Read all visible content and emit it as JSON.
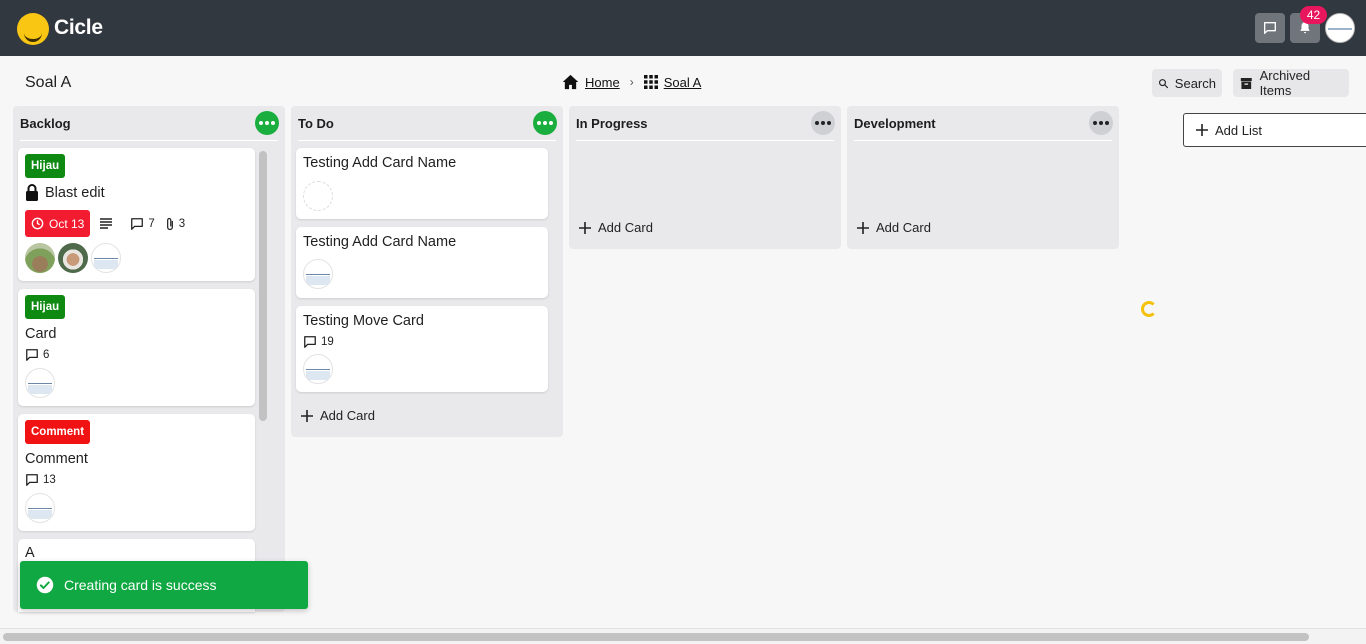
{
  "app": {
    "name": "Cicle",
    "notification_count": "42"
  },
  "header": {
    "page_title": "Soal A",
    "breadcrumb": [
      {
        "label": "Home",
        "icon": "home-icon"
      },
      {
        "label": "Soal A",
        "icon": "grid-icon"
      }
    ],
    "search_label": "Search",
    "archived_label": "Archived Items"
  },
  "lists": [
    {
      "title": "Backlog",
      "cards": [
        {
          "label": "Hijau",
          "title": "Blast edit",
          "due": "Oct 13",
          "comments": "7",
          "attachments": "3"
        },
        {
          "label": "Hijau",
          "title": "Card",
          "comments": "6"
        },
        {
          "label": "Comment",
          "title": "Comment",
          "comments": "13"
        },
        {
          "title": "A"
        }
      ]
    },
    {
      "title": "To Do",
      "cards": [
        {
          "title": "Testing Add Card Name"
        },
        {
          "title": "Testing Add Card Name"
        },
        {
          "title": "Testing Move Card",
          "comments": "19"
        }
      ],
      "add_card": "Add Card"
    },
    {
      "title": "In Progress",
      "cards": [],
      "add_card": "Add Card"
    },
    {
      "title": "Development",
      "cards": [],
      "add_card": "Add Card"
    }
  ],
  "add_list_label": "Add List",
  "toast": {
    "message": "Creating card is success"
  },
  "colors": {
    "topbar": "#323840",
    "accent_green": "#1aae3e",
    "label_green": "#0e8a12",
    "label_red": "#f11313",
    "due_red": "#f21b2f",
    "toast_green": "#10a842",
    "badge_pink": "#e8175d"
  }
}
